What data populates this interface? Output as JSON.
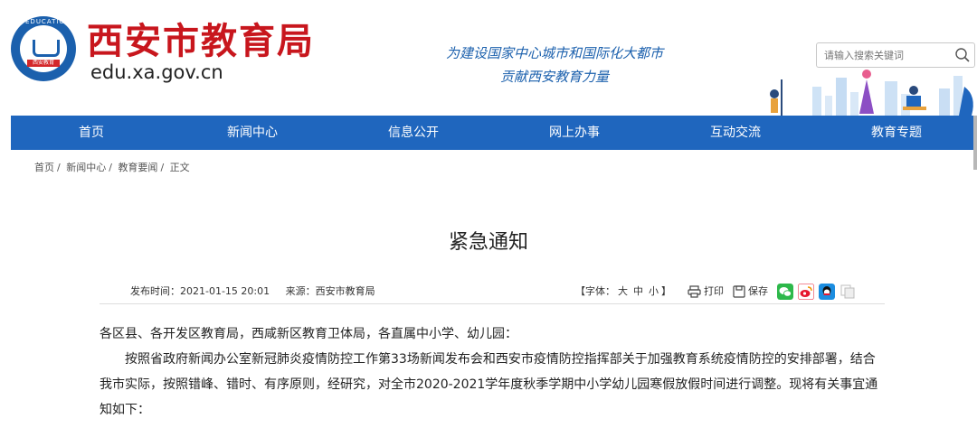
{
  "header": {
    "site_title": "西安市教育局",
    "domain": "edu.xa.gov.cn",
    "logo_arc_text": "EDUCATION",
    "logo_ribbon_text": "西安教育",
    "slogan_line1": "为建设国家中心城市和国际化大都市",
    "slogan_line2": "贡献西安教育力量",
    "search": {
      "placeholder": "请输入搜索关键词",
      "value": ""
    }
  },
  "nav": {
    "items": [
      {
        "label": "首页"
      },
      {
        "label": "新闻中心"
      },
      {
        "label": "信息公开"
      },
      {
        "label": "网上办事"
      },
      {
        "label": "互动交流"
      },
      {
        "label": "教育专题"
      }
    ]
  },
  "breadcrumb": [
    "首页",
    "新闻中心",
    "教育要闻",
    "正文"
  ],
  "breadcrumb_sep": "/",
  "article": {
    "title": "紧急通知",
    "publish_label": "发布时间：",
    "publish_time": "2021-01-15 20:01",
    "source_label": "来源：",
    "source": "西安市教育局",
    "font_label": "【字体：",
    "font_large": "大",
    "font_medium": "中",
    "font_small": "小",
    "font_close": "】",
    "print_label": "打印",
    "save_label": "保存",
    "paragraphs": [
      "各区县、各开发区教育局，西咸新区教育卫体局，各直属中小学、幼儿园：",
      "按照省政府新闻办公室新冠肺炎疫情防控工作第33场新闻发布会和西安市疫情防控指挥部关于加强教育系统疫情防控的安排部署，结合我市实际，按照错峰、错时、有序原则，经研究，对全市2020-2021学年度秋季学期中小学幼儿园寒假放假时间进行调整。现将有关事宜通知如下："
    ]
  },
  "colors": {
    "brand_blue": "#1f66be",
    "title_red": "#c8161d",
    "wechat_green": "#2db84a",
    "weibo_red": "#e6162d",
    "qq_blue": "#1b8de0"
  },
  "icons": [
    "search-icon",
    "print-icon",
    "save-icon",
    "wechat-icon",
    "weibo-icon",
    "qq-icon",
    "copy-icon"
  ]
}
